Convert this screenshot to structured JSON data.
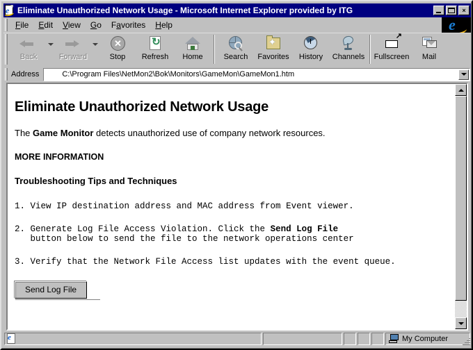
{
  "window": {
    "title": "Eliminate Unauthorized Network Usage - Microsoft Internet Explorer provided by ITG",
    "title_icon": "page-ie-icon",
    "controls": {
      "minimize": "_",
      "maximize": "□",
      "close": "×"
    }
  },
  "menu": {
    "items": [
      {
        "label": "File",
        "accel": "F"
      },
      {
        "label": "Edit",
        "accel": "E"
      },
      {
        "label": "View",
        "accel": "V"
      },
      {
        "label": "Go",
        "accel": "G"
      },
      {
        "label": "Favorites",
        "accel": "a"
      },
      {
        "label": "Help",
        "accel": "H"
      }
    ],
    "brand_icon": "internet-explorer-logo"
  },
  "toolbar": {
    "buttons": [
      {
        "label": "Back",
        "icon": "back-arrow-icon",
        "disabled": true,
        "has_dropdown": true
      },
      {
        "label": "Forward",
        "icon": "forward-arrow-icon",
        "disabled": true,
        "has_dropdown": true
      },
      {
        "label": "Stop",
        "icon": "stop-icon",
        "disabled": false,
        "has_dropdown": false
      },
      {
        "label": "Refresh",
        "icon": "refresh-icon",
        "disabled": false,
        "has_dropdown": false
      },
      {
        "label": "Home",
        "icon": "home-icon",
        "disabled": false,
        "has_dropdown": false
      },
      {
        "label": "Search",
        "icon": "search-globe-icon",
        "disabled": false,
        "has_dropdown": false
      },
      {
        "label": "Favorites",
        "icon": "favorites-folder-icon",
        "disabled": false,
        "has_dropdown": false
      },
      {
        "label": "History",
        "icon": "history-icon",
        "disabled": false,
        "has_dropdown": false
      },
      {
        "label": "Channels",
        "icon": "channels-dish-icon",
        "disabled": false,
        "has_dropdown": false
      },
      {
        "label": "Fullscreen",
        "icon": "fullscreen-icon",
        "disabled": false,
        "has_dropdown": false
      },
      {
        "label": "Mail",
        "icon": "mail-icon",
        "disabled": false,
        "has_dropdown": false
      }
    ]
  },
  "address": {
    "label": "Address",
    "value": "C:\\Program Files\\NetMon2\\Bok\\Monitors\\GameMon\\GameMon1.htm",
    "placeholder": "",
    "dropdown_icon": "chevron-down-icon"
  },
  "page": {
    "heading": "Eliminate Unauthorized Network Usage",
    "intro_before": "The ",
    "intro_bold": "Game Monitor",
    "intro_after": " detects unauthorized use of company network resources.",
    "more_information": "MORE INFORMATION",
    "subheading": "Troubleshooting Tips and Techniques",
    "steps": [
      {
        "text_before": "1. View IP destination address and MAC address from Event viewer.",
        "bold": "",
        "text_after": ""
      },
      {
        "text_before": "2. Generate Log File Access Violation. Click the ",
        "bold": "Send Log File",
        "text_after": "\n   button below to send the file to the network operations center"
      },
      {
        "text_before": "3. Verify that the Network File Access list updates with the event queue.",
        "bold": "",
        "text_after": ""
      }
    ],
    "button_label": "Send Log File"
  },
  "scrollbar": {
    "up_icon": "scroll-up-arrow-icon",
    "down_icon": "scroll-down-arrow-icon"
  },
  "statusbar": {
    "panes": [
      "",
      "",
      "",
      "",
      ""
    ],
    "zone_label": "My Computer",
    "zone_icon": "my-computer-icon",
    "page_icon": "page-ie-icon"
  },
  "colors": {
    "titlebar": "#000080",
    "face": "#c0c0c0",
    "page_bg": "#ffffff",
    "text": "#000000",
    "disabled_text": "#808080"
  }
}
